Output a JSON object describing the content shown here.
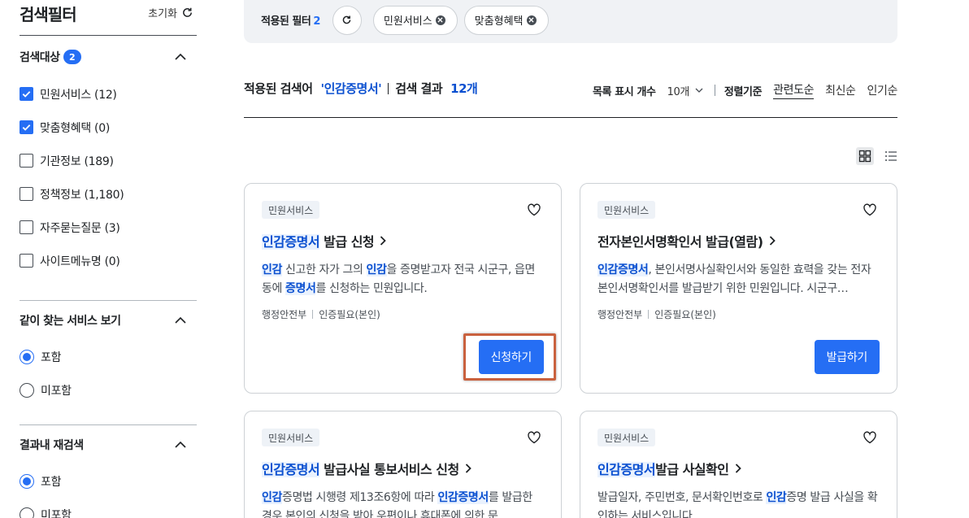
{
  "sidebar": {
    "title": "검색필터",
    "reset_label": "초기화",
    "sections": [
      {
        "title": "검색대상",
        "badge": "2",
        "options": [
          {
            "label": "민원서비스 (12)",
            "checked": true
          },
          {
            "label": "맞춤형혜택 (0)",
            "checked": true
          },
          {
            "label": "기관정보 (189)",
            "checked": false
          },
          {
            "label": "정책정보 (1,180)",
            "checked": false
          },
          {
            "label": "자주묻는질문 (3)",
            "checked": false
          },
          {
            "label": "사이트메뉴명 (0)",
            "checked": false
          }
        ]
      },
      {
        "title": "같이 찾는 서비스 보기",
        "options": [
          {
            "label": "포함",
            "selected": true
          },
          {
            "label": "미포함",
            "selected": false
          }
        ]
      },
      {
        "title": "결과내 재검색",
        "options": [
          {
            "label": "포함",
            "selected": true
          },
          {
            "label": "미포함",
            "selected": false
          }
        ]
      }
    ]
  },
  "filterbar": {
    "label": "적용된 필터",
    "count": "2",
    "chips": [
      "민원서비스",
      "맞춤형혜택"
    ]
  },
  "results": {
    "keyword_label": "적용된 검색어",
    "keyword": "'인감증명서'",
    "result_label": "검색 결과",
    "result_count": "12개",
    "page_size_label": "목록 표시 개수",
    "page_size_value": "10개",
    "sort_label": "정렬기준",
    "sort_options": [
      "관련도순",
      "최신순",
      "인기순"
    ],
    "active_sort": "관련도순"
  },
  "cards": [
    {
      "tag": "민원서비스",
      "title_parts": [
        {
          "t": "인감증명서",
          "hl": true
        },
        {
          "t": " 발급 신청",
          "hl": false
        }
      ],
      "desc_parts": [
        {
          "t": "인감",
          "hl": true
        },
        {
          "t": " 신고한 자가 그의 ",
          "hl": false
        },
        {
          "t": "인감",
          "hl": true
        },
        {
          "t": "을 증명받고자 전국 시군구, 읍면동에 ",
          "hl": false
        },
        {
          "t": "증명서",
          "hl": true
        },
        {
          "t": "를 신청하는 민원입니다.",
          "hl": false
        }
      ],
      "agency": "행정안전부",
      "auth": "인증필요(본인)",
      "button": "신청하기"
    },
    {
      "tag": "민원서비스",
      "title_parts": [
        {
          "t": "전자본인서명확인서 발급(열람)",
          "hl": false
        }
      ],
      "desc_parts": [
        {
          "t": "인감증명서",
          "hl": true
        },
        {
          "t": ", 본인서명사실확인서와 동일한 효력을 갖는 전자본인서명확인서를 발급받기 위한 민원입니다. 시군구…",
          "hl": false
        }
      ],
      "agency": "행정안전부",
      "auth": "인증필요(본인)",
      "button": "발급하기"
    },
    {
      "tag": "민원서비스",
      "title_parts": [
        {
          "t": "인감증명서",
          "hl": true
        },
        {
          "t": " 발급사실 통보서비스 신청",
          "hl": false
        }
      ],
      "desc_parts": [
        {
          "t": "인감",
          "hl": true
        },
        {
          "t": "증명법 시행령 제13조6항에 따라 ",
          "hl": false
        },
        {
          "t": "인감증명서",
          "hl": true
        },
        {
          "t": "를 발급한 경우 본인의 신청을 받아 우편이나 휴대폰에 의한 문…",
          "hl": false
        }
      ]
    },
    {
      "tag": "민원서비스",
      "title_parts": [
        {
          "t": "인감증명서",
          "hl": true
        },
        {
          "t": "발급 사실확인",
          "hl": false
        }
      ],
      "desc_parts": [
        {
          "t": "발급일자, 주민번호, 문서확인번호로 ",
          "hl": false
        },
        {
          "t": "인감",
          "hl": true
        },
        {
          "t": "증명 발급 사실을 확인하는 서비스입니다.",
          "hl": false
        }
      ]
    }
  ]
}
